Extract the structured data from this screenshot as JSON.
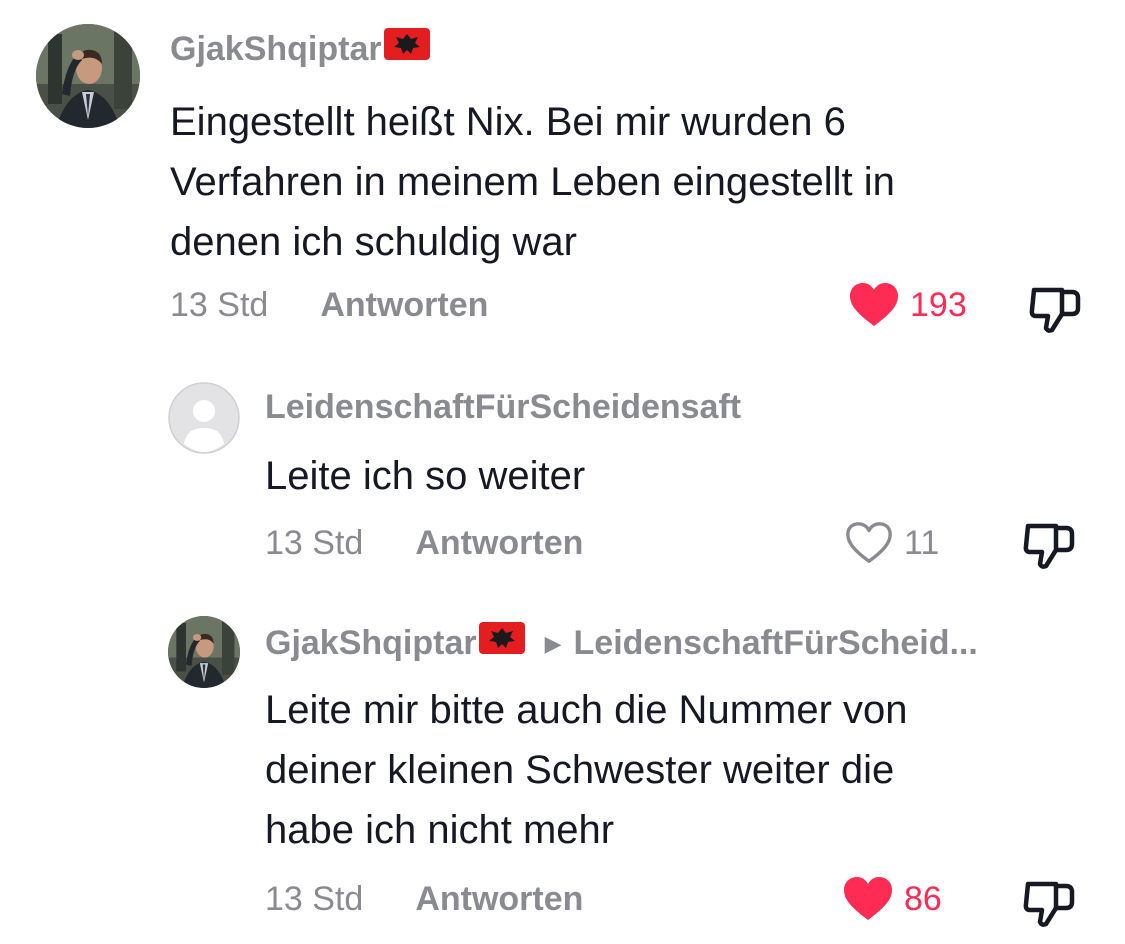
{
  "comments": [
    {
      "username": "GjakShqiptar",
      "text_lines": [
        "Eingestellt heißt Nix. Bei mir wurden 6",
        "Verfahren in meinem Leben eingestellt in",
        "denen ich schuldig war"
      ],
      "time": "13 Std",
      "reply_label": "Antworten",
      "likes": "193",
      "liked": true
    },
    {
      "username": "LeidenschaftFürScheidensaft",
      "text_lines": [
        "Leite ich so weiter"
      ],
      "time": "13 Std",
      "reply_label": "Antworten",
      "likes": "11",
      "liked": false
    },
    {
      "username": "GjakShqiptar",
      "reply_to": "LeidenschaftFürScheid...",
      "text_lines": [
        "Leite mir bitte auch die Nummer von",
        "deiner kleinen Schwester weiter die",
        "habe ich nicht mehr"
      ],
      "time": "13 Std",
      "reply_label": "Antworten",
      "likes": "86",
      "liked": true
    }
  ],
  "icons": {
    "like": "heart-icon",
    "dislike": "thumbs-down-icon",
    "flag": "albanian-flag-icon",
    "reply_caret": "caret-right-icon"
  },
  "colors": {
    "like_active": "#fe2c55",
    "muted": "#8a8b91",
    "text": "#161823",
    "flag_red": "#e41e20"
  }
}
